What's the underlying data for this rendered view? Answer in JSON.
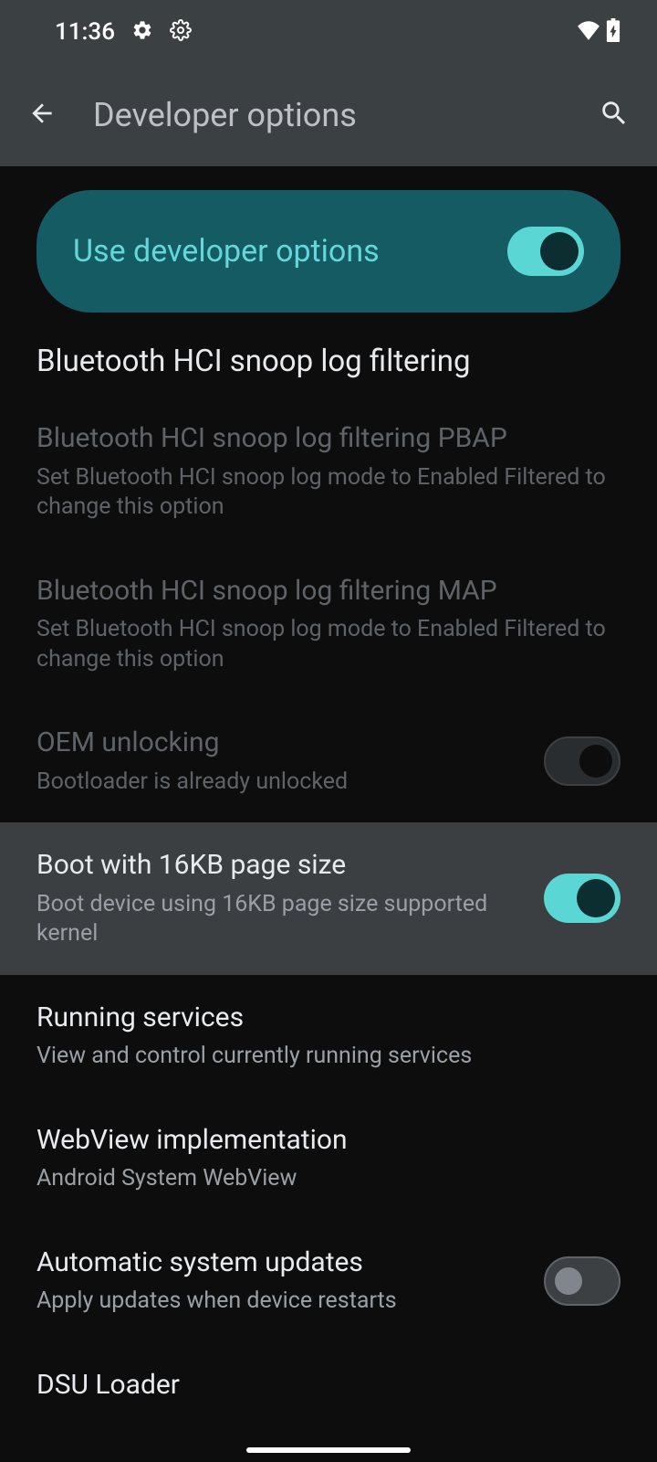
{
  "statusBar": {
    "time": "11:36"
  },
  "appBar": {
    "title": "Developer options"
  },
  "masterToggle": {
    "label": "Use developer options",
    "enabled": true
  },
  "sectionHeader": "Bluetooth HCI snoop log filtering",
  "settings": [
    {
      "title": "Bluetooth HCI snoop log filtering PBAP",
      "subtitle": "Set Bluetooth HCI snoop log mode to Enabled Filtered to change this option",
      "disabled": true,
      "toggle": null
    },
    {
      "title": "Bluetooth HCI snoop log filtering MAP",
      "subtitle": "Set Bluetooth HCI snoop log mode to Enabled Filtered to change this option",
      "disabled": true,
      "toggle": null
    },
    {
      "title": "OEM unlocking",
      "subtitle": "Bootloader is already unlocked",
      "disabled": true,
      "toggle": false
    },
    {
      "title": "Boot with 16KB page size",
      "subtitle": "Boot device using 16KB page size supported kernel",
      "disabled": false,
      "toggle": true,
      "highlighted": true
    },
    {
      "title": "Running services",
      "subtitle": "View and control currently running services",
      "disabled": false,
      "toggle": null
    },
    {
      "title": "WebView implementation",
      "subtitle": "Android System WebView",
      "disabled": false,
      "toggle": null
    },
    {
      "title": "Automatic system updates",
      "subtitle": "Apply updates when device restarts",
      "disabled": false,
      "toggle": false
    },
    {
      "title": "DSU Loader",
      "subtitle": "",
      "disabled": false,
      "toggle": null
    }
  ]
}
